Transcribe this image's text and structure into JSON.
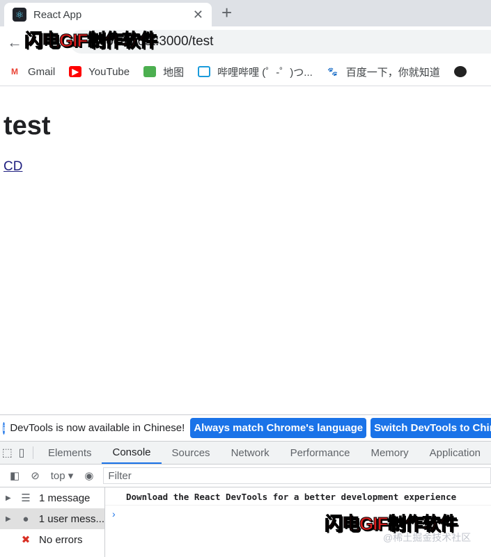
{
  "browser": {
    "tab_title": "React App",
    "url": "localhost:3000/test",
    "bookmarks": [
      "Gmail",
      "YouTube",
      "地图",
      "哔哩哔哩 (゜-゜)つ...",
      "百度一下，你就知道"
    ]
  },
  "page": {
    "heading": "test",
    "link": "CD"
  },
  "devtools": {
    "info_text": "DevTools is now available in Chinese!",
    "btn_match": "Always match Chrome's language",
    "btn_switch": "Switch DevTools to Chinese",
    "tabs": [
      "Elements",
      "Console",
      "Sources",
      "Network",
      "Performance",
      "Memory",
      "Application"
    ],
    "active_tab": "Console",
    "context": "top",
    "filter_placeholder": "Filter",
    "sidebar": [
      "1 message",
      "1 user mess...",
      "No errors"
    ],
    "message": "Download the React DevTools for a better development experience"
  },
  "watermark": {
    "gif": "闪电GIF制作软件",
    "site": "@稀土掘金技术社区"
  }
}
